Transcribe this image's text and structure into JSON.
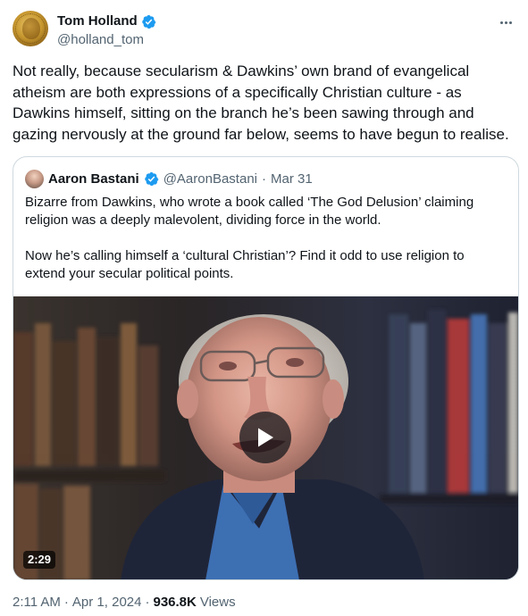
{
  "author": {
    "display_name": "Tom Holland",
    "handle": "@holland_tom",
    "verified": true,
    "avatar_icon": "gold-coin-avatar"
  },
  "tweet_text": "Not really, because secularism & Dawkins’ own brand of evangelical atheism are both expressions of a specifically Christian culture - as Dawkins himself, sitting on the branch he’s been sawing through and gazing nervously at the ground far below, seems to have begun to realise.",
  "quoted": {
    "display_name": "Aaron Bastani",
    "handle": "@AaronBastani",
    "separator": "·",
    "date": "Mar 31",
    "verified": true,
    "paragraphs": [
      "Bizarre from Dawkins, who wrote a book called ‘The God Delusion’ claiming religion was a deeply malevolent, dividing force in the world.",
      "Now he’s calling himself a ‘cultural Christian’? Find it odd to use religion to extend your secular political points."
    ],
    "video": {
      "duration": "2:29",
      "play_icon": "play-icon"
    }
  },
  "meta": {
    "time": "2:11 AM",
    "separator": "·",
    "date": "Apr 1, 2024",
    "views_count": "936.8K",
    "views_label": "Views"
  },
  "colors": {
    "verified_blue": "#1d9bf0",
    "secondary_text": "#536471",
    "primary_text": "#0f1419",
    "border": "#cfd9de"
  }
}
